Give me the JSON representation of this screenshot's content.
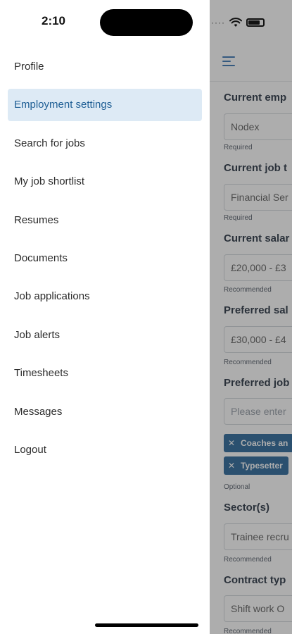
{
  "status_bar": {
    "time": "2:10"
  },
  "drawer": {
    "items": [
      {
        "label": "Profile",
        "active": false
      },
      {
        "label": "Employment settings",
        "active": true
      },
      {
        "label": "Search for jobs",
        "active": false
      },
      {
        "label": "My job shortlist",
        "active": false
      },
      {
        "label": "Resumes",
        "active": false
      },
      {
        "label": "Documents",
        "active": false
      },
      {
        "label": "Job applications",
        "active": false
      },
      {
        "label": "Job alerts",
        "active": false
      },
      {
        "label": "Timesheets",
        "active": false
      },
      {
        "label": "Messages",
        "active": false
      },
      {
        "label": "Logout",
        "active": false
      }
    ]
  },
  "form": {
    "current_employer": {
      "label": "Current emp",
      "value": "Nodex",
      "hint": "Required"
    },
    "current_job_title": {
      "label": "Current job t",
      "value": "Financial Ser",
      "hint": "Required"
    },
    "current_salary": {
      "label": "Current salar",
      "value": "£20,000 - £3",
      "hint": "Recommended"
    },
    "preferred_salary": {
      "label": "Preferred sal",
      "value": "£30,000 - £4",
      "hint": "Recommended"
    },
    "preferred_job": {
      "label": "Preferred job",
      "placeholder": "Please enter",
      "chips": [
        "Coaches an",
        "Typesetter"
      ],
      "hint": "Optional"
    },
    "sectors": {
      "label": "Sector(s)",
      "value": "Trainee recru",
      "hint": "Recommended"
    },
    "contract_type": {
      "label": "Contract typ",
      "value": "Shift work O",
      "hint": "Recommended"
    }
  },
  "colors": {
    "accent": "#1f5f95",
    "active_bg": "#ddeaf5"
  }
}
